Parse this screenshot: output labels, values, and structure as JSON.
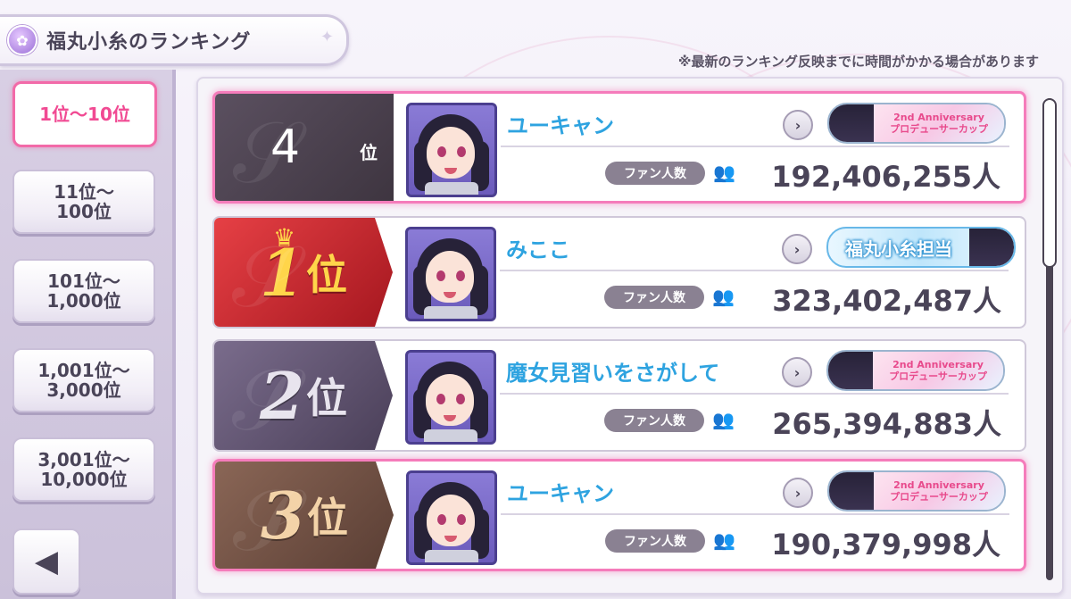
{
  "title": "福丸小糸のランキング",
  "notice": "※最新のランキング反映までに時間がかかる場合があります",
  "sidebar": {
    "items": [
      {
        "label": "1位〜10位",
        "active": true
      },
      {
        "label": "11位〜\n100位",
        "active": false
      },
      {
        "label": "101位〜\n1,000位",
        "active": false
      },
      {
        "label": "1,001位〜\n3,000位",
        "active": false
      },
      {
        "label": "3,001位〜\n10,000位",
        "active": false
      }
    ],
    "back_icon": "arrow-left-icon"
  },
  "fan_label": "ファン人数",
  "rows": [
    {
      "rank": "4",
      "unit": "位",
      "name": "ユーキャン",
      "fans": "192,406,255人",
      "badge": "2nd Anniversary プロデューサーカップ",
      "badge_type": "anniversary",
      "highlight": true
    },
    {
      "rank": "1",
      "unit": "位",
      "name": "みここ",
      "fans": "323,402,487人",
      "badge": "福丸小糸担当",
      "badge_type": "blue",
      "highlight": false
    },
    {
      "rank": "2",
      "unit": "位",
      "name": "魔女見習いをさがして",
      "fans": "265,394,883人",
      "badge": "2nd Anniversary プロデューサーカップ",
      "badge_type": "anniversary",
      "highlight": false
    },
    {
      "rank": "3",
      "unit": "位",
      "name": "ユーキャン",
      "fans": "190,379,998人",
      "badge": "2nd Anniversary プロデューサーカップ",
      "badge_type": "anniversary",
      "highlight": true
    }
  ],
  "badge_anniv": {
    "line1": "2nd Anniversary",
    "line2": "プロデューサーカップ"
  },
  "colors": {
    "accent_pink": "#f26aa8",
    "name_blue": "#2ea3e0",
    "gold": "#ffd54a"
  }
}
